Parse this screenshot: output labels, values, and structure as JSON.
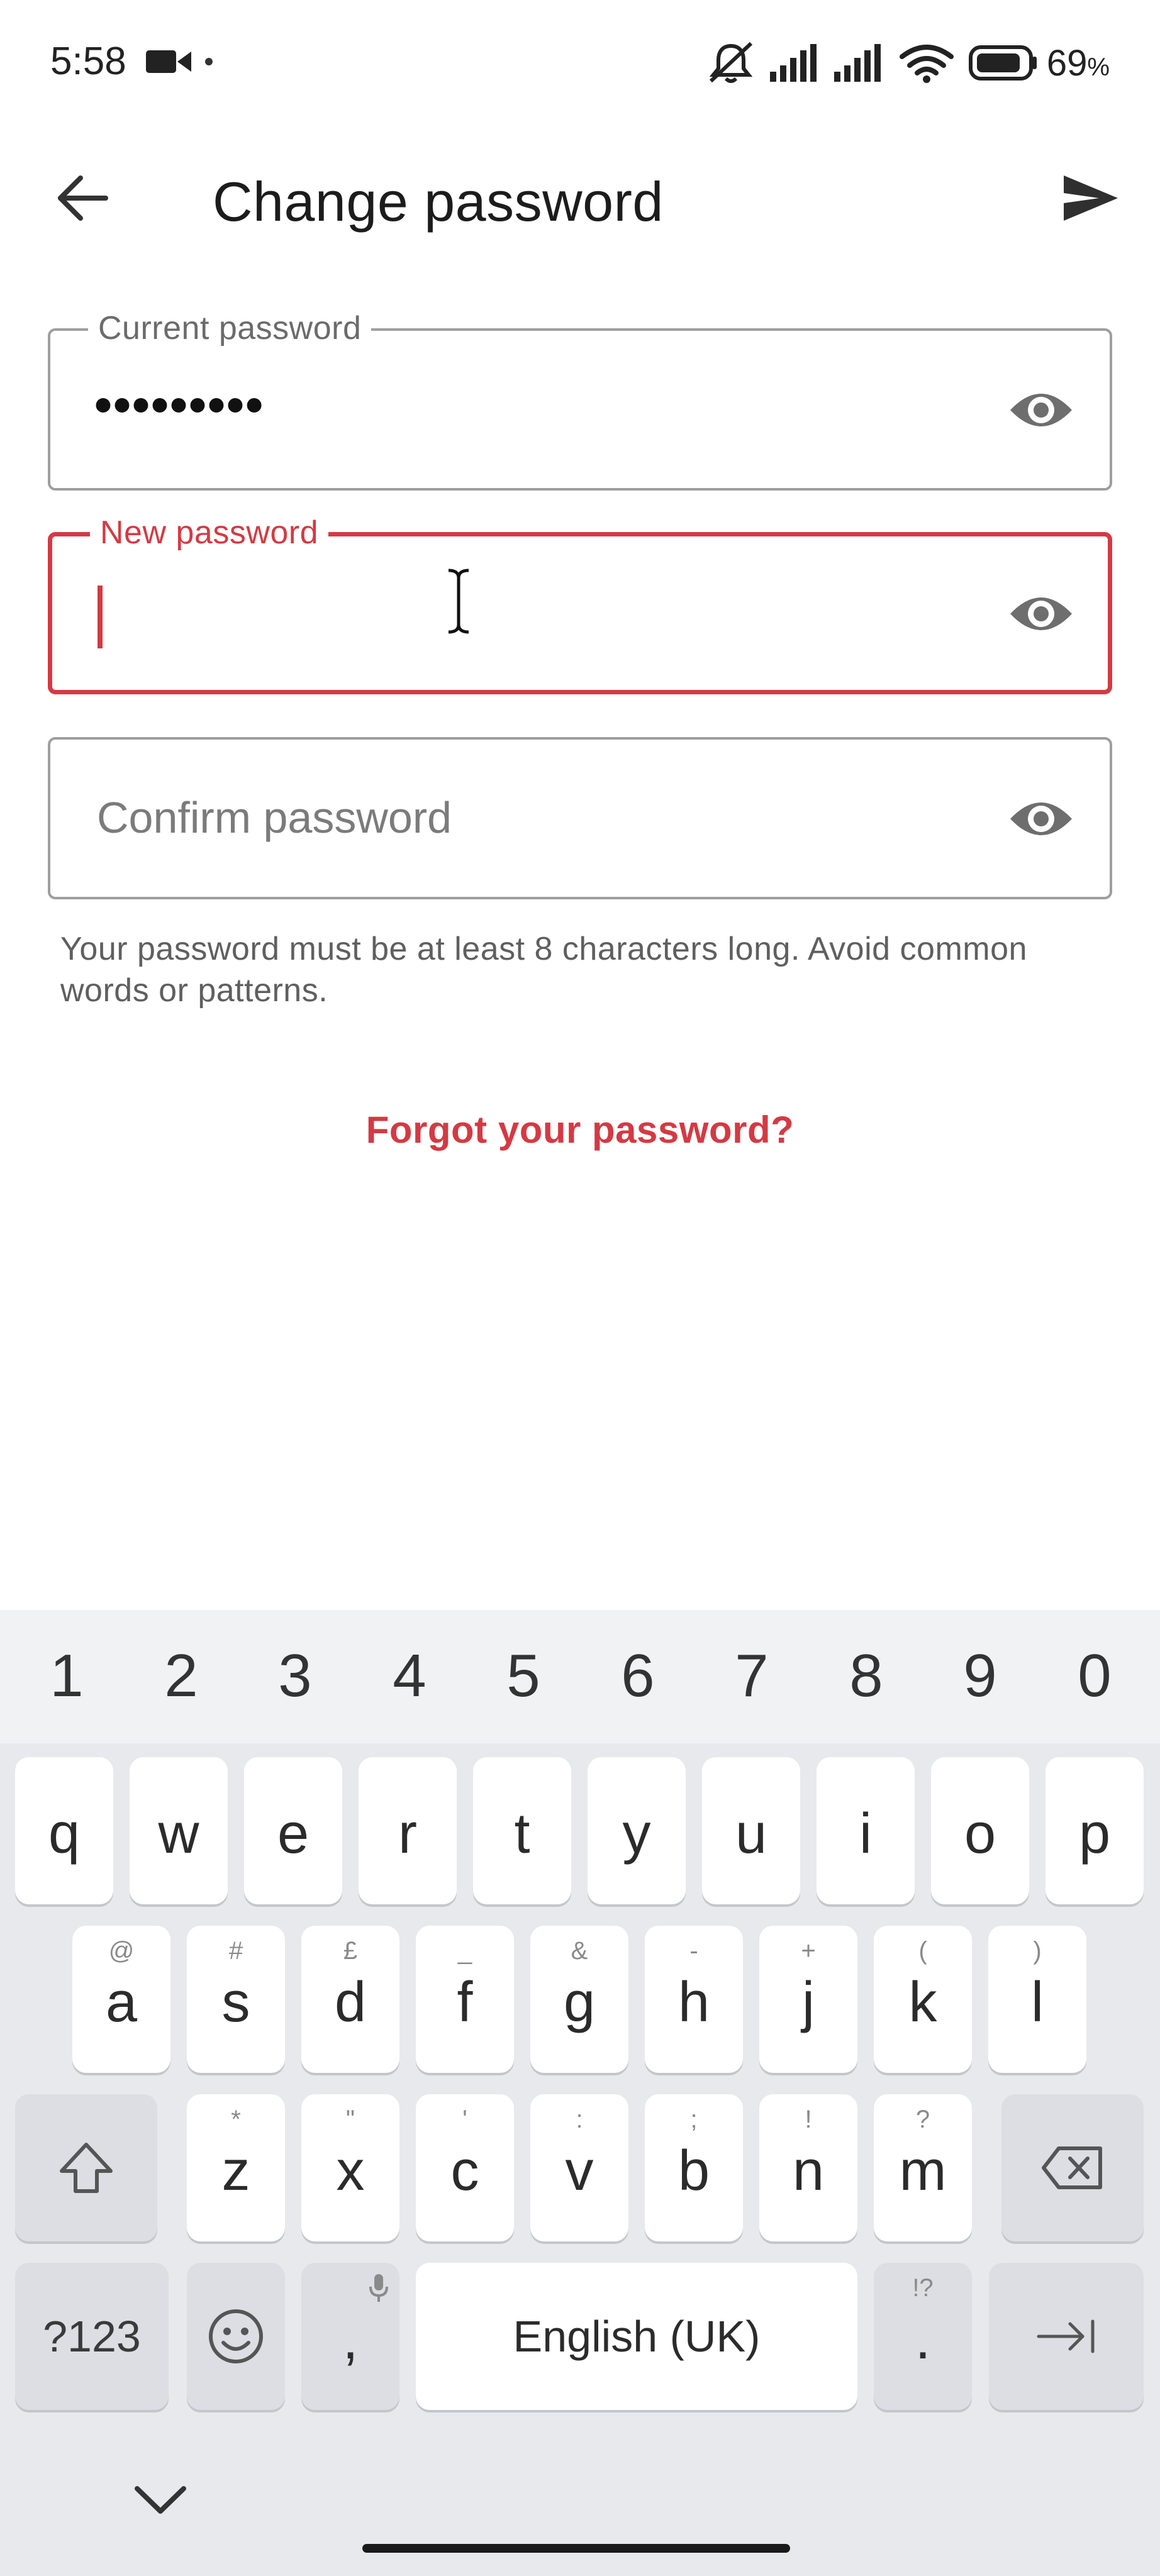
{
  "status_bar": {
    "time": "5:58",
    "battery_percent": "69",
    "battery_unit": "%",
    "icons": [
      "video-camera-icon",
      "muted-bell-icon",
      "signal-icon",
      "signal-icon",
      "wifi-icon",
      "battery-icon"
    ]
  },
  "app_bar": {
    "title": "Change password",
    "back_icon": "arrow-back-icon",
    "send_icon": "send-icon"
  },
  "form": {
    "current_password": {
      "label": "Current password",
      "value": "•••••••••"
    },
    "new_password": {
      "label": "New password",
      "value": "",
      "state": "focused"
    },
    "confirm_password": {
      "placeholder": "Confirm password"
    },
    "helper_text": "Your password must be at least 8 characters long. Avoid common words or patterns.",
    "forgot_link": "Forgot your password?",
    "accent_color": "#d43a43"
  },
  "keyboard": {
    "numbers": [
      "1",
      "2",
      "3",
      "4",
      "5",
      "6",
      "7",
      "8",
      "9",
      "0"
    ],
    "row1": [
      "q",
      "w",
      "e",
      "r",
      "t",
      "y",
      "u",
      "i",
      "o",
      "p"
    ],
    "row2": [
      {
        "key": "a",
        "hint": "@"
      },
      {
        "key": "s",
        "hint": "#"
      },
      {
        "key": "d",
        "hint": "£"
      },
      {
        "key": "f",
        "hint": "_"
      },
      {
        "key": "g",
        "hint": "&"
      },
      {
        "key": "h",
        "hint": "-"
      },
      {
        "key": "j",
        "hint": "+"
      },
      {
        "key": "k",
        "hint": "("
      },
      {
        "key": "l",
        "hint": ")"
      }
    ],
    "row3": [
      {
        "key": "z",
        "hint": "*"
      },
      {
        "key": "x",
        "hint": "\""
      },
      {
        "key": "c",
        "hint": "'"
      },
      {
        "key": "v",
        "hint": ":"
      },
      {
        "key": "b",
        "hint": ";"
      },
      {
        "key": "n",
        "hint": "!"
      },
      {
        "key": "m",
        "hint": "?"
      }
    ],
    "symbols_label": "?123",
    "comma": ",",
    "space_label": "English (UK)",
    "period": ".",
    "period_hint": "!?"
  }
}
